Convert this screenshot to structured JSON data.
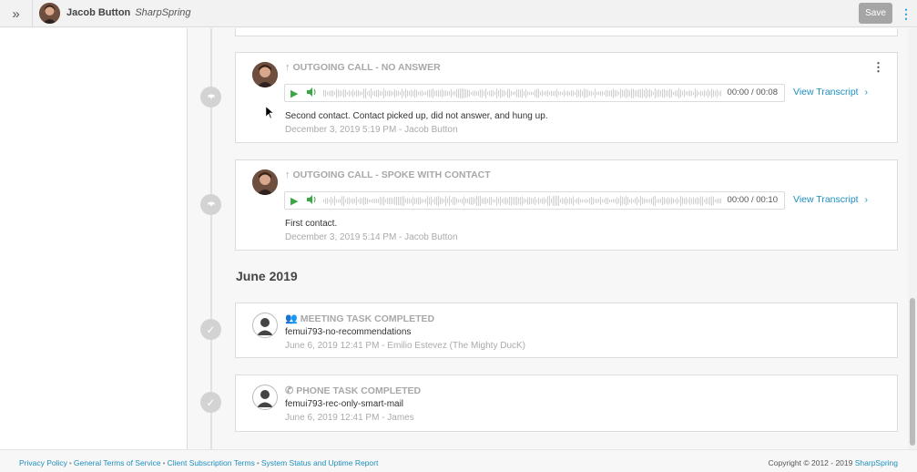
{
  "header": {
    "expand_icon": "double-chevron-right-icon",
    "user_name": "Jacob Button",
    "company": "SharpSpring",
    "save_label": "Save",
    "more_icon": "vertical-dots-icon"
  },
  "timeline": {
    "cards": [
      {
        "title": "OUTGOING CALL - NO ANSWER",
        "direction_icon": "arrow-up-icon",
        "audio_time": "00:00 / 00:08",
        "transcript_label": "View Transcript",
        "note": "Second contact. Contact picked up, did not answer, and hung up.",
        "meta": "December 3, 2019 5:19 PM  -  Jacob Button"
      },
      {
        "title": "OUTGOING CALL - SPOKE WITH CONTACT",
        "direction_icon": "arrow-up-icon",
        "audio_time": "00:00 / 00:10",
        "transcript_label": "View Transcript",
        "note": "First contact.",
        "meta": "December 3, 2019 5:14 PM  -  Jacob Button"
      }
    ],
    "month_heading": "June 2019",
    "tasks": [
      {
        "title": "MEETING TASK COMPLETED",
        "icon": "people-icon",
        "name": "femui793-no-recommendations",
        "meta": "June 6, 2019 12:41 PM  -  Emilio Estevez (The Mighty DucK)"
      },
      {
        "title": "PHONE TASK COMPLETED",
        "icon": "phone-icon",
        "name": "femui793-rec-only-smart-mail",
        "meta": "June 6, 2019 12:41 PM  -  James"
      }
    ]
  },
  "footer": {
    "links": [
      "Privacy Policy",
      "General Terms of Service",
      "Client Subscription Terms",
      "System Status and Uptime Report"
    ],
    "separator": "•",
    "copyright_prefix": "Copyright © 2012 - 2019 ",
    "copyright_brand": "SharpSpring"
  },
  "colors": {
    "accent_blue": "#1e8fbf",
    "play_green": "#3aa842",
    "save_gray": "#a5a5a5"
  }
}
